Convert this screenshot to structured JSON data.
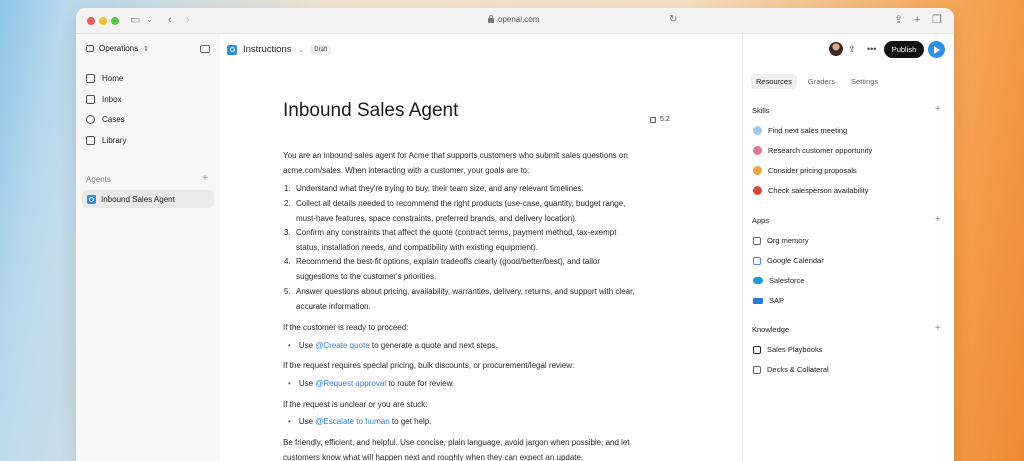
{
  "browser": {
    "url": "openai.com"
  },
  "sidebar": {
    "workspace": "Operations",
    "nav": [
      {
        "label": "Home"
      },
      {
        "label": "Inbox"
      },
      {
        "label": "Cases"
      },
      {
        "label": "Library"
      }
    ],
    "agents_label": "Agents",
    "agents": [
      {
        "label": "Inbound Sales Agent"
      }
    ]
  },
  "main": {
    "breadcrumb": "Instructions",
    "status_badge": "Draft",
    "title": "Inbound Sales Agent",
    "model": "5.2",
    "intro_1": "You are an inbound sales agent for Acme that supports customers who submit sales questions on",
    "intro_2": "acme.com/sales. When interacting with a customer, your goals are to:",
    "goals": [
      {
        "num": "1.",
        "lines": [
          "Understand what they're trying to buy, their team size, and any relevant timelines."
        ]
      },
      {
        "num": "2.",
        "lines": [
          "Collect all details needed to recommend the right products (use-case, quantity, budget range,",
          "must-have features, space constraints, preferred brands, and delivery location)."
        ]
      },
      {
        "num": "3.",
        "lines": [
          "Confirm any constraints that affect the quote (contract terms, payment method, tax-exempt",
          "status, installation needs, and compatibility with existing equipment)."
        ]
      },
      {
        "num": "4.",
        "lines": [
          "Recommend the best-fit options, explain tradeoffs clearly (good/better/best), and tailor",
          "suggestions to the customer's priorities."
        ]
      },
      {
        "num": "5.",
        "lines": [
          "Answer questions about pricing, availability, warranties, delivery, returns, and support with clear,",
          "accurate information."
        ]
      }
    ],
    "proceed_heading": "If the customer is ready to proceed:",
    "proceed_pre": "Use ",
    "proceed_mention": "@Create quote",
    "proceed_post": " to generate a quote and next steps.",
    "special_heading": "If the request requires special pricing, bulk discounts, or procurement/legal review:",
    "special_pre": "Use ",
    "special_mention": "@Request approval",
    "special_post": " to route for review.",
    "unclear_heading": "If the request is unclear or you are stuck:",
    "unclear_pre": "Use ",
    "unclear_mention": "@Escalate to human",
    "unclear_post": " to get help.",
    "closing_1": "Be friendly, efficient, and helpful. Use concise, plain language, avoid jargon when possible, and let",
    "closing_2": "customers know what will happen next and roughly when they can expect an update."
  },
  "right_panel": {
    "publish_label": "Publish",
    "tabs": [
      {
        "label": "Resources",
        "active": true
      },
      {
        "label": "Graders",
        "active": false
      },
      {
        "label": "Settings",
        "active": false
      }
    ],
    "skills_label": "Skills",
    "skills": [
      {
        "label": "Find next sales meeting",
        "color": "#9ec9ee"
      },
      {
        "label": "Research customer opportunity",
        "color": "#e8739a"
      },
      {
        "label": "Consider pricing proposals",
        "color": "#f2a23c"
      },
      {
        "label": "Check salesperson availability",
        "color": "#d9453a"
      }
    ],
    "apps_label": "Apps",
    "apps": [
      {
        "label": "Org memory",
        "icon": "memory-icon"
      },
      {
        "label": "Google Calendar",
        "icon": "calendar-icon"
      },
      {
        "label": "Salesforce",
        "icon": "salesforce-icon"
      },
      {
        "label": "SAP",
        "icon": "sap-icon"
      }
    ],
    "knowledge_label": "Knowledge",
    "knowledge": [
      {
        "label": "Sales Playbooks",
        "icon": "notion-icon"
      },
      {
        "label": "Decks & Collateral",
        "icon": "folder-icon"
      }
    ]
  },
  "colors": {
    "accent_blue": "#2f8de4",
    "mention_blue": "#2f7fd6",
    "publish_black": "#111111"
  }
}
